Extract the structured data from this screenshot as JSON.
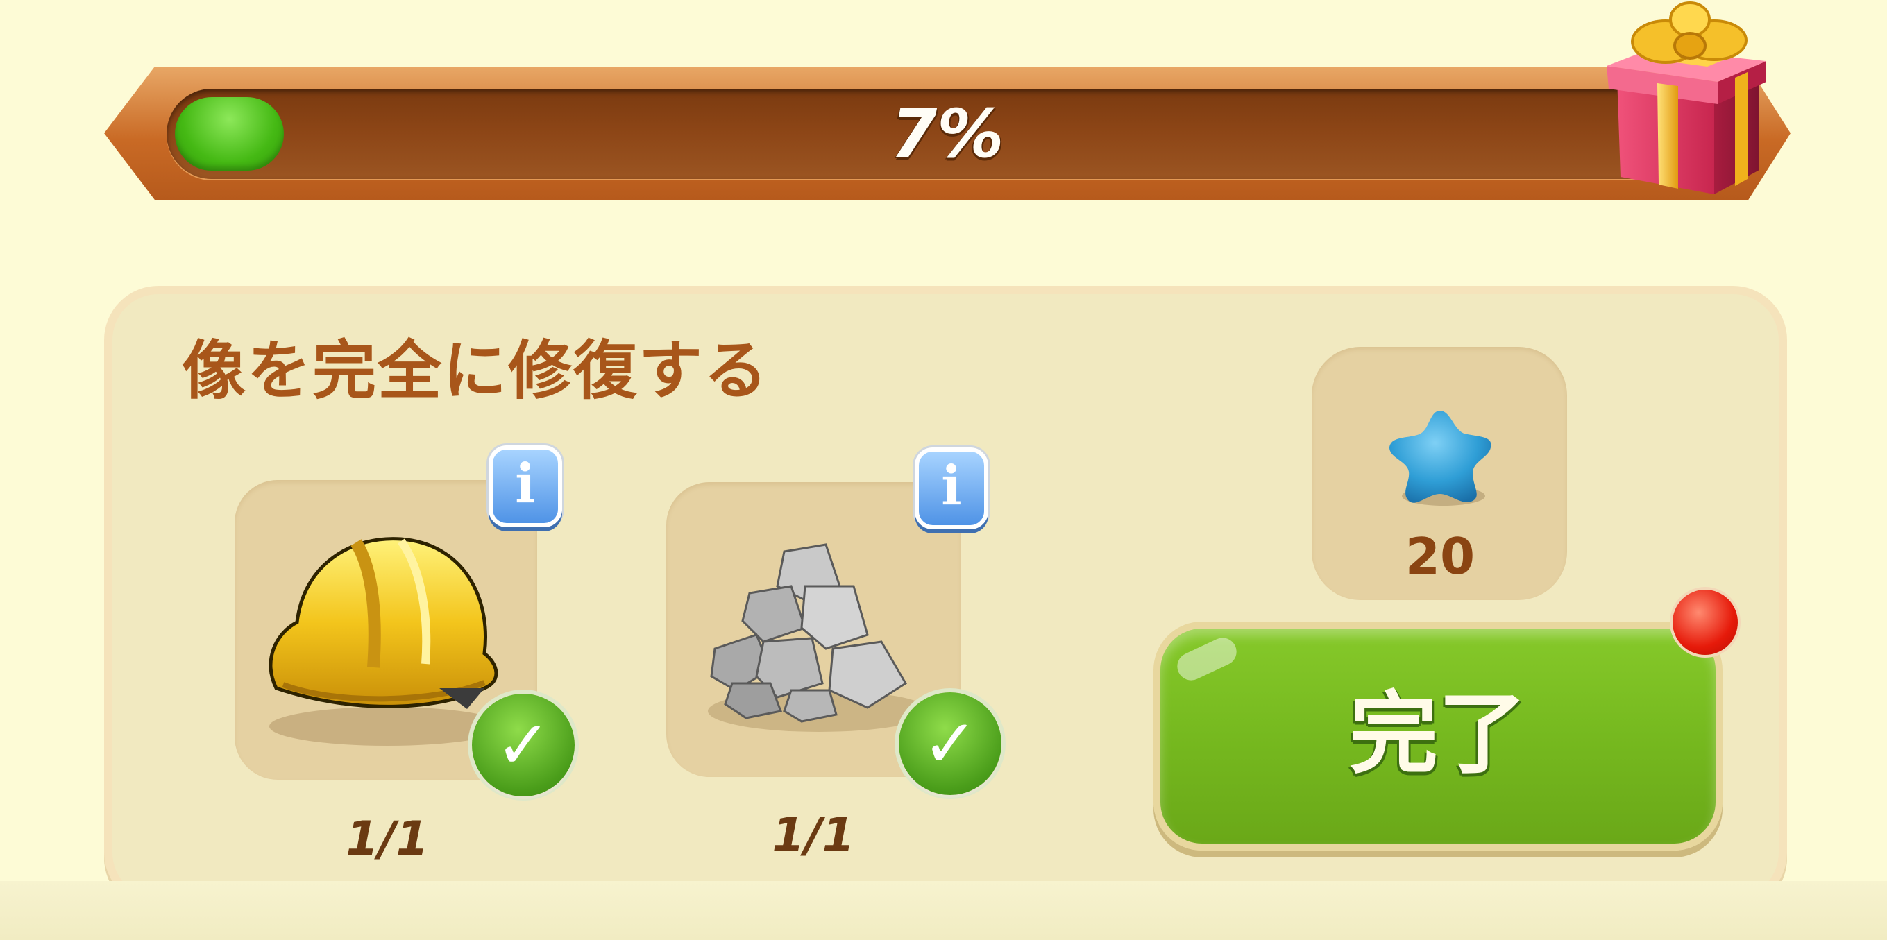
{
  "progress": {
    "percent_label": "7%",
    "fraction": 0.07
  },
  "task": {
    "title": "像を完全に修復する",
    "items": [
      {
        "icon": "hard-hat-icon",
        "count": "1/1",
        "completed": true
      },
      {
        "icon": "rocks-icon",
        "count": "1/1",
        "completed": true
      }
    ]
  },
  "reward": {
    "icon": "blue-star-icon",
    "amount": "20"
  },
  "complete_button": {
    "label": "完了",
    "color": "#76b91f"
  },
  "colors": {
    "background": "#fdfbd6",
    "progress_fill": "#45b914",
    "title_text": "#a8561a",
    "notification_dot": "#e61a0a"
  }
}
